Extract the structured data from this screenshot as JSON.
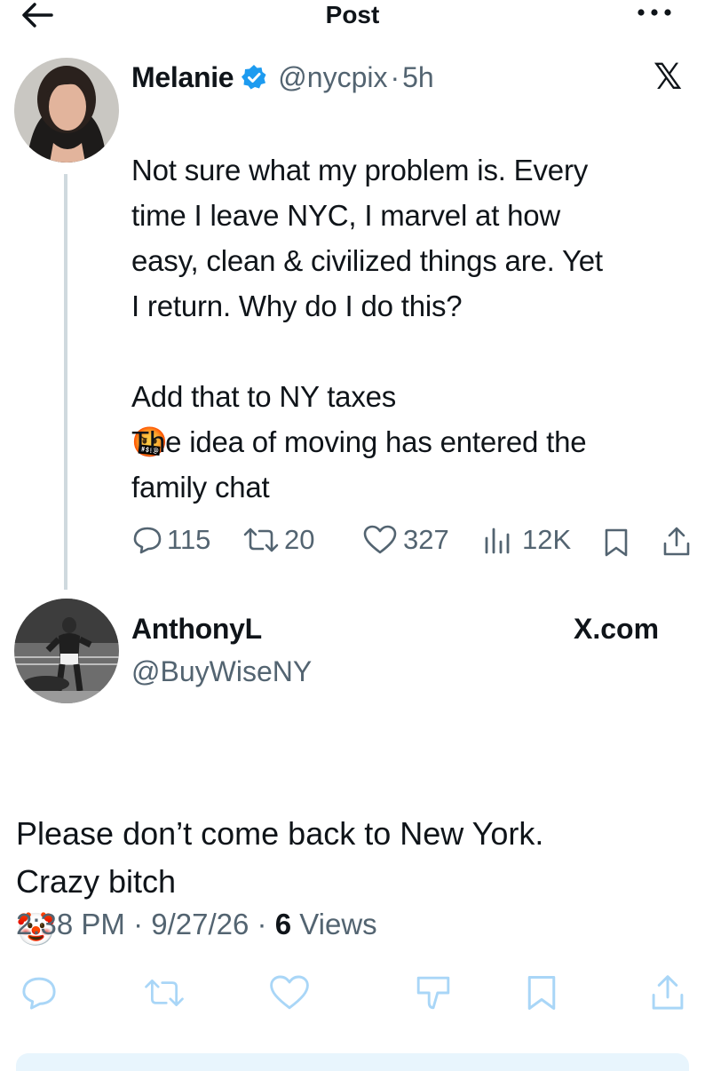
{
  "header": {
    "title": "Post",
    "back_icon": "arrow-left-icon",
    "more_icon": "more-dots-icon"
  },
  "quoted_post": {
    "author_name": "Melanie",
    "verified": true,
    "handle": "@nycpix",
    "separator": "·",
    "time": "5h",
    "text": "Not sure what my problem is. Every\ntime I leave NYC, I marvel at how\neasy, clean & civilized things are. Yet\nI return. Why do I do this?\n\nAdd that to NY taxes",
    "emoji_cursing": "🤬",
    "text2": "The idea of moving has entered the\nfamily chat",
    "stats": {
      "replies": "115",
      "reposts": "20",
      "likes": "327",
      "views": "12K"
    },
    "accent": "#1d9bf0"
  },
  "reply": {
    "author_name": "AnthonyL",
    "handle": "@BuyWiseNY",
    "source": "X.com",
    "text": "Please don’t come back to New York.\nCrazy bitch",
    "emoji_clown": "🤡"
  },
  "meta": {
    "time": "2:38 PM",
    "separator": "·",
    "date": "9/27/26",
    "views_count": "6",
    "views_label": "Views"
  }
}
